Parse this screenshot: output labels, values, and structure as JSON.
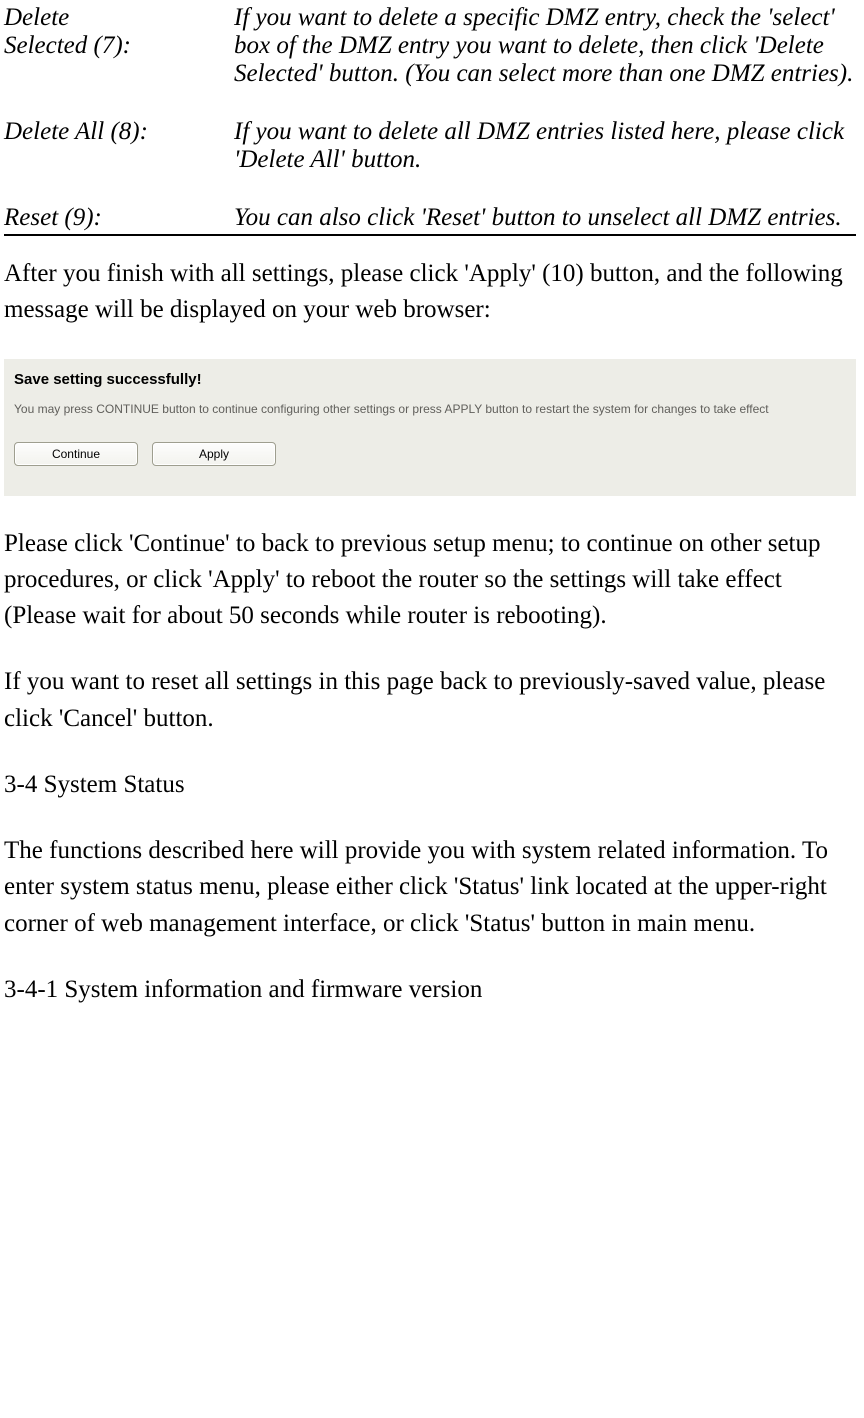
{
  "definitions": {
    "deleteSelected": {
      "term1": "Delete",
      "term2": "Selected (7):",
      "desc": "If you want to delete a specific DMZ entry, check the 'select' box of the DMZ entry you want to delete, then click 'Delete Selected' button. (You can select more than one DMZ entries)."
    },
    "deleteAll": {
      "term": "Delete All (8):",
      "desc": "If you want to delete all DMZ entries listed here, please click 'Delete All' button."
    },
    "reset": {
      "term": "Reset (9):",
      "desc": "You can also click 'Reset' button to unselect all DMZ entries."
    }
  },
  "para_afterFinish": "After you finish with all settings, please click 'Apply' (10) button, and the following message will be displayed on your web browser:",
  "screenshot": {
    "title": "Save setting successfully!",
    "desc": "You may press CONTINUE button to continue configuring other settings or press APPLY button to restart the system for changes to take effect",
    "continueBtn": "Continue",
    "applyBtn": "Apply"
  },
  "para_continue": "Please click 'Continue' to back to previous setup menu; to continue on other setup procedures, or click 'Apply' to reboot the router so the settings will take effect (Please wait for about 50 seconds while router is rebooting).",
  "para_reset": "If you want to reset all settings in this page back to previously-saved value, please click 'Cancel' button.",
  "heading_34": "3-4 System Status",
  "para_34": "The functions described here will provide you with system related information. To enter system status menu, please either click 'Status' link located at the upper-right corner of web management interface, or click 'Status' button in main menu.",
  "heading_341": "3-4-1 System information and firmware version"
}
